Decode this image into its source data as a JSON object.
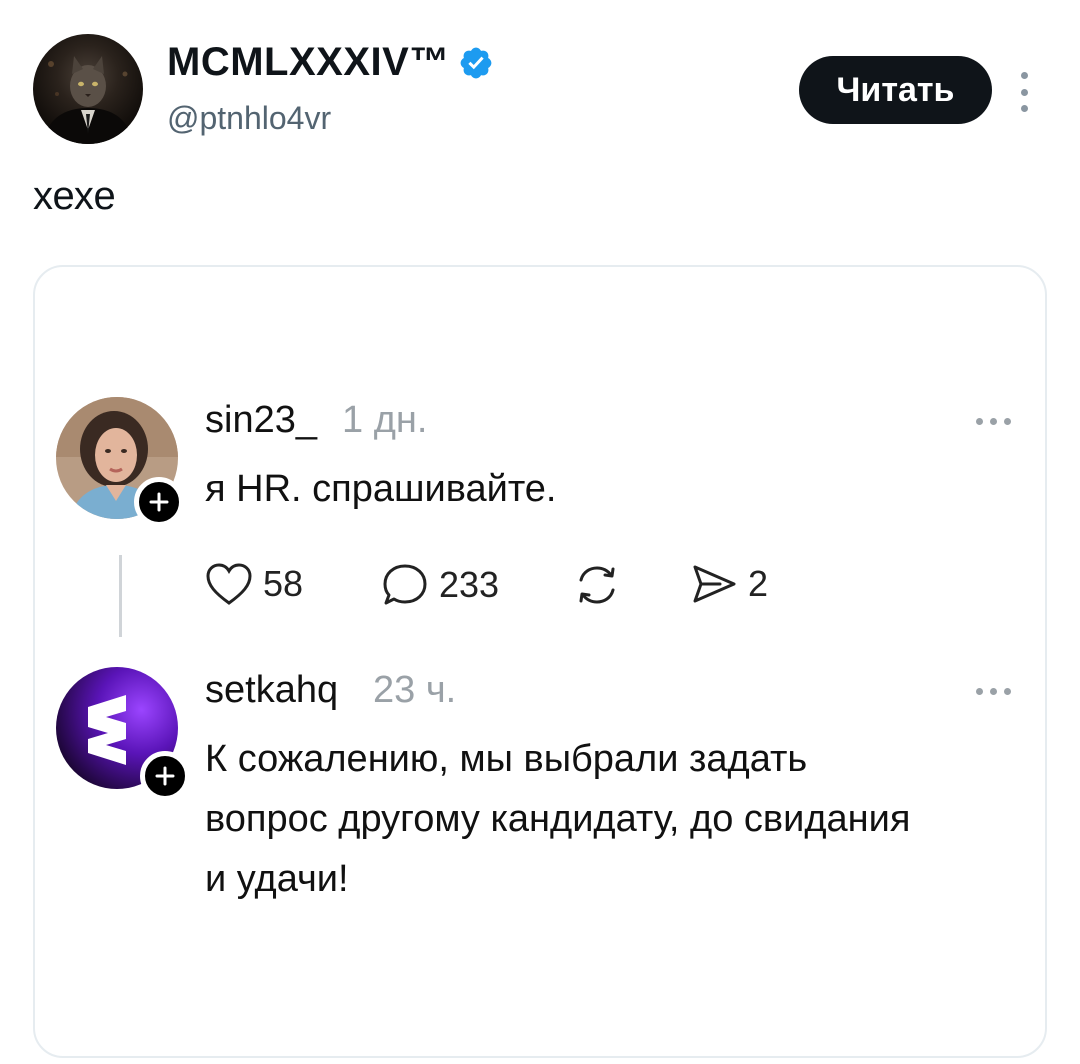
{
  "author": {
    "name": "MCMLXXXIV™",
    "handle": "@ptnhlo4vr",
    "verified": true,
    "avatar_icon": "cat-in-suit-avatar"
  },
  "header": {
    "follow_label": "Читать",
    "more_icon": "more-vertical-icon"
  },
  "tweet": {
    "text": "хехе"
  },
  "screenshot": {
    "posts": [
      {
        "username": "sin23_",
        "time": "1 дн.",
        "text": "я HR. спрашивайте.",
        "avatar_icon": "woman-portrait-avatar",
        "actions": {
          "likes": "58",
          "replies": "233",
          "shares": "2"
        }
      },
      {
        "username": "setkahq",
        "time": "23 ч.",
        "text_lines": [
          "К сожалению, мы выбрали задать",
          "вопрос другому кандидату, до свидания",
          "и удачи!"
        ],
        "avatar_icon": "setka-logo-avatar"
      }
    ]
  },
  "colors": {
    "verified_blue": "#1d9bf0",
    "button_bg": "#0f1419",
    "muted_text": "#536471",
    "setka_purple": "#7b2cf5"
  }
}
